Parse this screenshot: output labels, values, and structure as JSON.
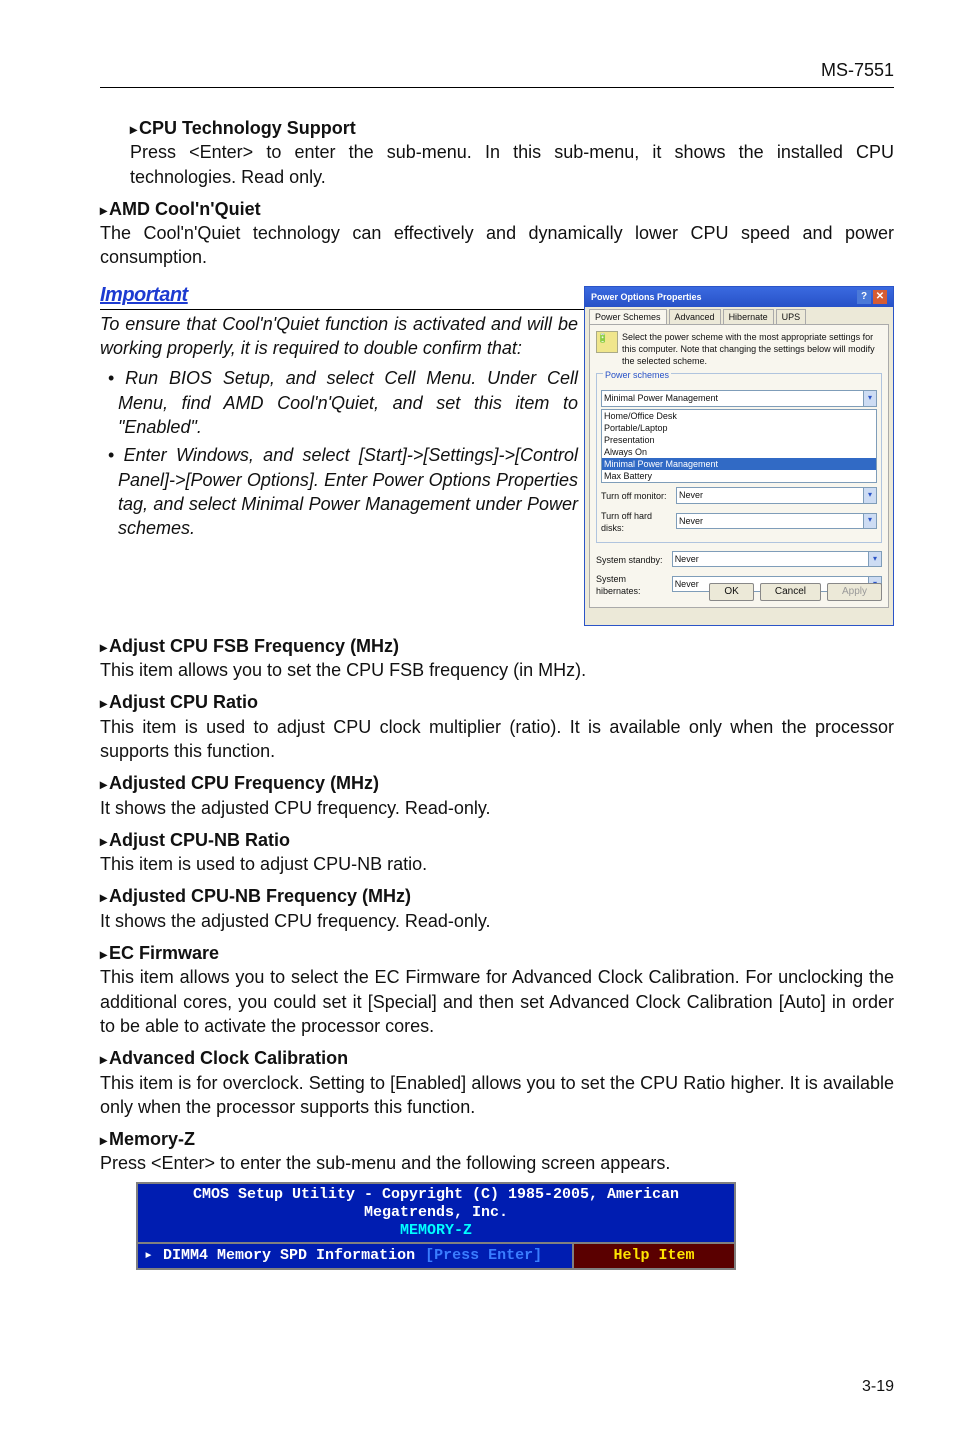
{
  "header": {
    "model": "MS-7551"
  },
  "sections": {
    "cpuTechSupport": {
      "title": "CPU Technology Support",
      "body": "Press <Enter> to enter the sub-menu. In this sub-menu, it shows the installed CPU technologies. Read only."
    },
    "amdCoolQuiet": {
      "title": "AMD Cool'n'Quiet",
      "body": "The Cool'n'Quiet technology can effectively and dynamically lower CPU speed and power consumption."
    },
    "important": {
      "label": "Important",
      "intro": "To ensure that Cool'n'Quiet function is activated and will be working properly, it is required to double confirm that:",
      "bullets": [
        "Run BIOS Setup, and select Cell Menu. Under Cell Menu, find AMD Cool'n'Quiet, and set this item to \"Enabled\".",
        "Enter Windows, and select [Start]->[Settings]->[Control Panel]->[Power Options]. Enter Power Options Properties tag, and select Minimal Power Management under Power schemes."
      ]
    },
    "adjustFSB": {
      "title": "Adjust CPU FSB Frequency (MHz)",
      "body": "This item allows you to set the CPU FSB frequency (in MHz)."
    },
    "adjustRatio": {
      "title": "Adjust CPU Ratio",
      "body": "This item is used to adjust CPU clock multiplier (ratio). It is available only when the processor supports this function."
    },
    "adjustedFreq": {
      "title": "Adjusted CPU Frequency (MHz)",
      "body": "It shows the adjusted CPU frequency. Read-only."
    },
    "adjustNBRatio": {
      "title": "Adjust CPU-NB Ratio",
      "body": "This item is used to adjust CPU-NB ratio."
    },
    "adjustedNBFreq": {
      "title": "Adjusted CPU-NB Frequency (MHz)",
      "body": "It shows the adjusted CPU frequency. Read-only."
    },
    "ecFirmware": {
      "title": "EC Firmware",
      "body": "This item allows you to select the EC Firmware for Advanced Clock Calibration. For unclocking the additional cores, you could set it [Special] and then set Advanced Clock Calibration [Auto] in order to be able to activate the processor cores."
    },
    "advClock": {
      "title": "Advanced Clock Calibration",
      "body": "This item is for overclock. Setting to [Enabled] allows you to set the CPU Ratio higher. It is available only when the processor supports this function."
    },
    "memoryZ": {
      "title": "Memory-Z",
      "body": "Press <Enter> to enter the sub-menu and the following screen appears."
    }
  },
  "powerDialog": {
    "title": "Power Options Properties",
    "tabs": [
      "Power Schemes",
      "Advanced",
      "Hibernate",
      "UPS"
    ],
    "hint": "Select the power scheme with the most appropriate settings for this computer. Note that changing the settings below will modify the selected scheme.",
    "legend": "Power schemes",
    "selected": "Minimal Power Management",
    "options": [
      "Home/Office Desk",
      "Portable/Laptop",
      "Presentation",
      "Always On",
      "Minimal Power Management",
      "Max Battery"
    ],
    "rows": {
      "monitor": {
        "label": "Turn off monitor:",
        "value": "Never"
      },
      "disks": {
        "label": "Turn off hard disks:",
        "value": "Never"
      },
      "standby": {
        "label": "System standby:",
        "value": "Never"
      },
      "hibernate": {
        "label": "System hibernates:",
        "value": "Never"
      }
    },
    "buttons": {
      "ok": "OK",
      "cancel": "Cancel",
      "apply": "Apply"
    }
  },
  "bios": {
    "line1": "CMOS Setup Utility - Copyright (C) 1985-2005, American Megatrends, Inc.",
    "line2": "MEMORY-Z",
    "left_arrow": "▸",
    "left_text": "DIMM4 Memory SPD Information",
    "left_value": "[Press Enter]",
    "right": "Help Item"
  },
  "footer": {
    "page": "3-19"
  }
}
